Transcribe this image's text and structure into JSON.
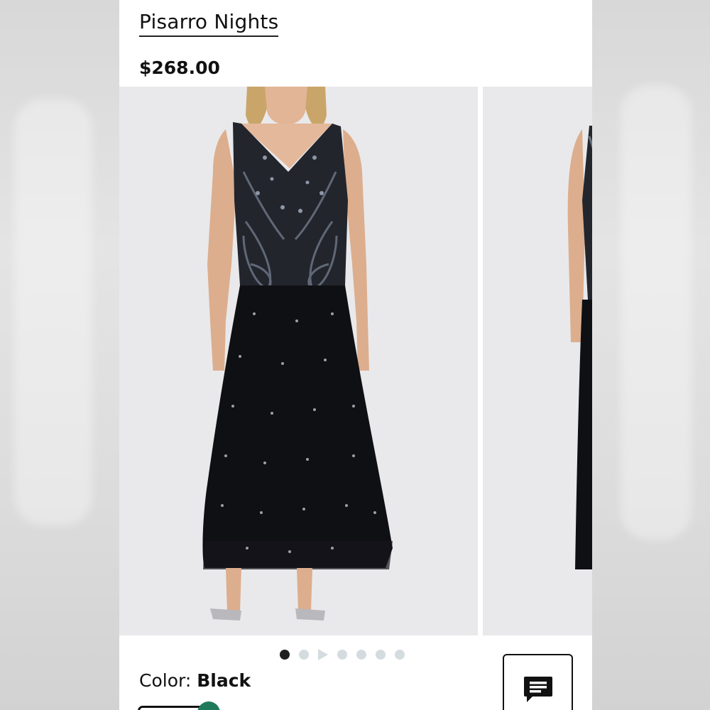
{
  "product": {
    "brand": "Pisarro Nights",
    "price": "$268.00"
  },
  "gallery": {
    "slides": [
      {
        "label": "Black beaded sleeveless maxi dress, front view"
      },
      {
        "label": "Black beaded sleeveless maxi dress, side view"
      }
    ],
    "pager_count": 7,
    "active_index": 0,
    "video_index": 2
  },
  "color": {
    "label": "Color:",
    "value": "Black"
  },
  "icons": {
    "chat": "chat-icon",
    "play": "play-icon"
  },
  "colors": {
    "accent": "#1f7a5c",
    "text": "#111111",
    "dot_inactive": "#d4dcdf",
    "image_bg": "#e9e9eb"
  }
}
